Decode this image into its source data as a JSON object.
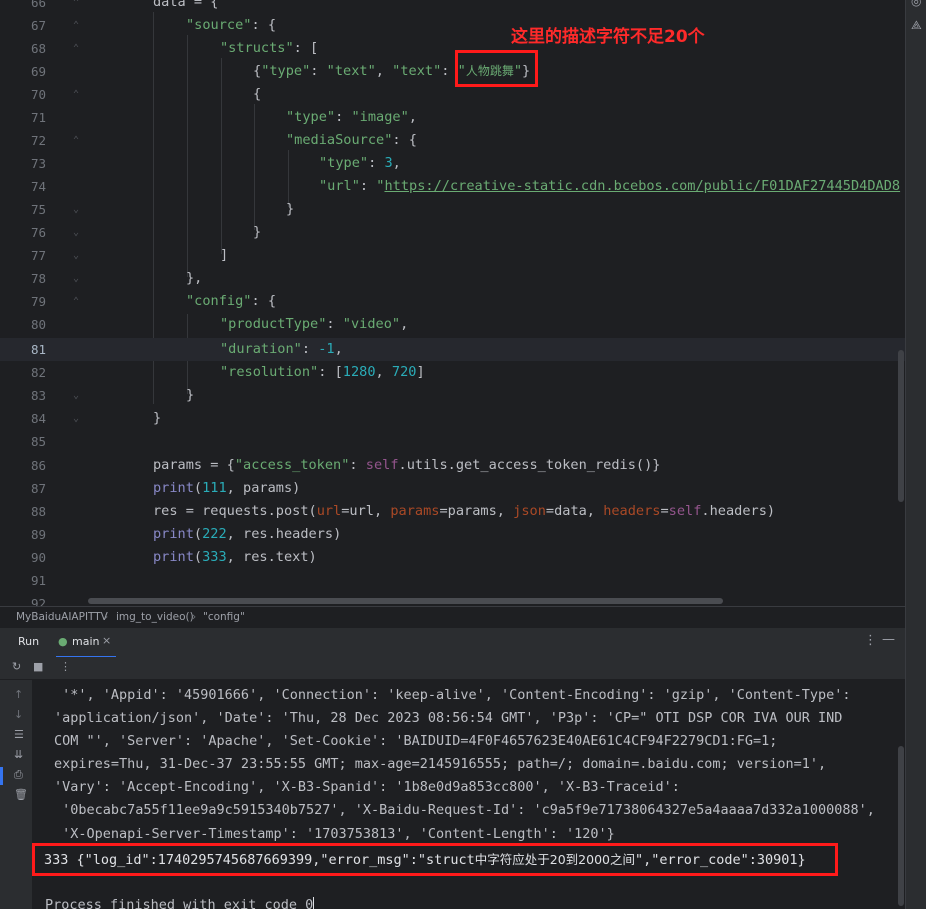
{
  "editor": {
    "line_numbers": [
      "66",
      "67",
      "68",
      "69",
      "70",
      "71",
      "72",
      "73",
      "74",
      "75",
      "76",
      "77",
      "78",
      "79",
      "80",
      "81",
      "82",
      "83",
      "84",
      "85",
      "86",
      "87",
      "88",
      "89",
      "90",
      "91",
      "92"
    ],
    "current_line": "81",
    "code": {
      "l66_var": "data",
      "l66_rest": " = {",
      "l67_key": "\"source\"",
      "l67_rest": ": {",
      "l68_key": "\"structs\"",
      "l68_rest": ": [",
      "l69_a": "{",
      "l69_k1": "\"type\"",
      "l69_c1": ": ",
      "l69_v1": "\"text\"",
      "l69_c2": ", ",
      "l69_k2": "\"text\"",
      "l69_c3": ": ",
      "l69_q1": "\"",
      "l69_v2": "人物跳舞",
      "l69_q2": "\"",
      "l69_end": "}",
      "l70": "{",
      "l71_key": "\"type\"",
      "l71_c": ": ",
      "l71_val": "\"image\"",
      "l71_end": ",",
      "l72_key": "\"mediaSource\"",
      "l72_rest": ": {",
      "l73_key": "\"type\"",
      "l73_c": ": ",
      "l73_val": "3",
      "l73_end": ",",
      "l74_key": "\"url\"",
      "l74_c": ": ",
      "l74_q": "\"",
      "l74_url": "https://creative-static.cdn.bcebos.com/public/F01DAF27445D4DAD8",
      "l75": "}",
      "l76": "}",
      "l77": "]",
      "l78": "},",
      "l79_key": "\"config\"",
      "l79_rest": ": {",
      "l80_key": "\"productType\"",
      "l80_c": ": ",
      "l80_val": "\"video\"",
      "l80_end": ",",
      "l81_key": "\"duration\"",
      "l81_c": ": ",
      "l81_val": "-1",
      "l81_end": ",",
      "l82_key": "\"resolution\"",
      "l82_c": ": [",
      "l82_v1": "1280",
      "l82_sep": ", ",
      "l82_v2": "720",
      "l82_end": "]",
      "l83": "}",
      "l84": "}",
      "l86_a": "params = {",
      "l86_key": "\"access_token\"",
      "l86_c": ": ",
      "l86_self": "self",
      "l86_rest": ".utils.get_access_token_redis()}",
      "l87_fn": "print",
      "l87_a": "(",
      "l87_n": "111",
      "l87_rest": ", params)",
      "l88_a": "res = requests.post(",
      "l88_p1": "url",
      "l88_b": "=url, ",
      "l88_p2": "params",
      "l88_c": "=params, ",
      "l88_p3": "json",
      "l88_d": "=data, ",
      "l88_p4": "headers",
      "l88_e": "=",
      "l88_self": "self",
      "l88_f": ".headers)",
      "l89_fn": "print",
      "l89_a": "(",
      "l89_n": "222",
      "l89_rest": ", res.headers)",
      "l90_fn": "print",
      "l90_a": "(",
      "l90_n": "333",
      "l90_rest": ", res.text)"
    },
    "annotation": "这里的描述字符不足20个"
  },
  "breadcrumb": {
    "items": [
      "MyBaiduAIAPITTV",
      "img_to_video()",
      "\"config\""
    ],
    "separator": "›"
  },
  "run_panel": {
    "label": "Run",
    "tab": "main",
    "tab_close": "×",
    "more": "⋮",
    "minimize": "—",
    "console_lines": [
      " '*', 'Appid': '45901666', 'Connection': 'keep-alive', 'Content-Encoding': 'gzip', 'Content-Type':",
      "'application/json', 'Date': 'Thu, 28 Dec 2023 08:56:54 GMT', 'P3p': 'CP=\" OTI DSP COR IVA OUR IND",
      "COM \"', 'Server': 'Apache', 'Set-Cookie': 'BAIDUID=4F0F4657623E40AE61C4CF94F2279CD1:FG=1;",
      "expires=Thu, 31-Dec-37 23:55:55 GMT; max-age=2145916555; path=/; domain=.baidu.com; version=1',",
      "'Vary': 'Accept-Encoding', 'X-B3-Spanid': '1b8e0d9a853cc800', 'X-B3-Traceid':",
      " '0becabc7a55f11ee9a9c5915340b7527', 'X-Baidu-Request-Id': 'c9a5f9e71738064327e5a4aaaa7d332a1000088',",
      " 'X-Openapi-Server-Timestamp': '1703753813', 'Content-Length': '120'}"
    ],
    "output_prefix": "333 {\"log_id\":1740295745687669399,\"error_msg\":\"struct",
    "output_cn": "中字符应处于20到2000之间",
    "output_suffix": "\",\"error_code\":30901}",
    "exit_message": "Process finished with exit code 0"
  },
  "colors": {
    "keyword": "#cf8e6d",
    "string": "#6aab73",
    "number": "#2aacb8",
    "annotation": "#ff2a2a",
    "accent": "#3574f0"
  }
}
